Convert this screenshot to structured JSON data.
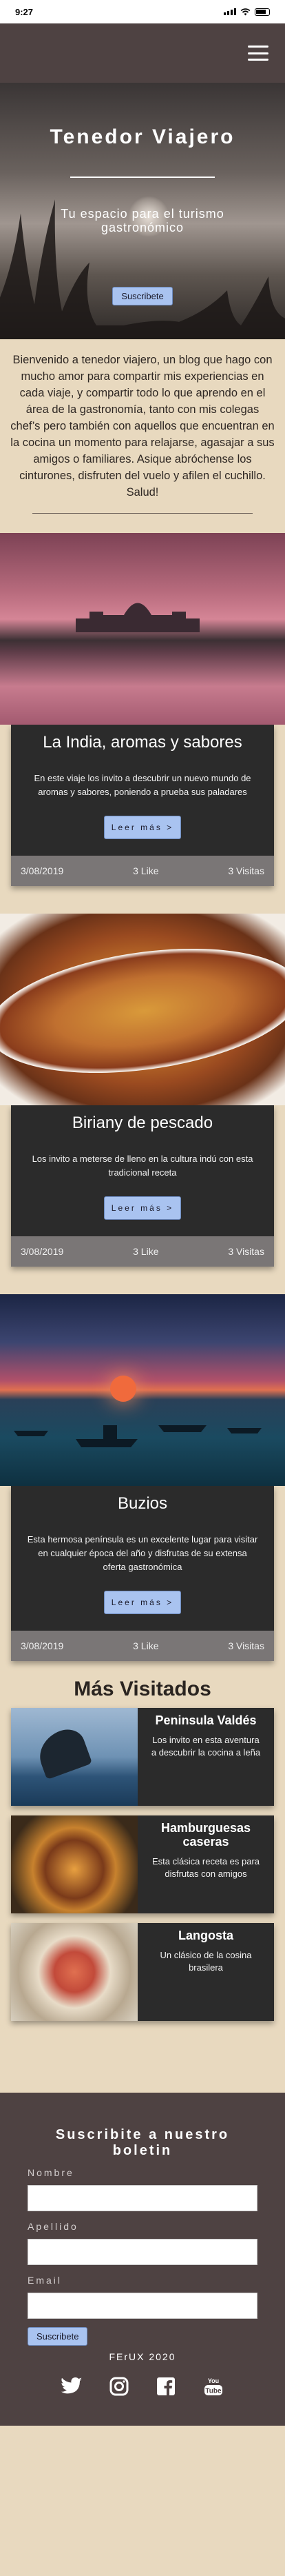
{
  "status_bar": {
    "time": "9:27"
  },
  "hero": {
    "title": "Tenedor Viajero",
    "subtitle": "Tu espacio para el turismo gastronómico",
    "button": "Suscribete"
  },
  "intro": {
    "text": "Bienvenido a tenedor viajero, un blog que hago con mucho amor para compartir mis experiencias en cada viaje, y compartir todo lo que aprendo en el área de la gastronomía, tanto con mis colegas chef’s pero también con aquellos que encuentran en la cocina un momento para relajarse, agasajar a sus amigos o familiares. Asique abróchense los cinturones, disfruten del vuelo y afilen el cuchillo. Salud!"
  },
  "posts": [
    {
      "title": "La India, aromas y sabores",
      "text": "En este viaje los invito a descubrir un nuevo mundo de aromas y sabores, poniendo a prueba sus paladares",
      "button": "Leer más",
      "date": "3/08/2019",
      "likes": "3 Like",
      "visits": "3 Visitas"
    },
    {
      "title": "Biriany de pescado",
      "text": "Los invito a meterse de lleno en la cultura indú con esta tradicional receta",
      "button": "Leer más",
      "date": "3/08/2019",
      "likes": "3 Like",
      "visits": "3 Visitas"
    },
    {
      "title": "Buzios",
      "text": "Esta hermosa península es un excelente lugar para visitar en cualquier época del año y disfrutas de su extensa oferta gastronómica",
      "button": "Leer más",
      "date": "3/08/2019",
      "likes": "3 Like",
      "visits": "3 Visitas"
    }
  ],
  "mas_visitados": {
    "title": "Más Visitados",
    "items": [
      {
        "title": "Peninsula Valdés",
        "text": "Los invito en esta aventura a descubrir la cocina a leña"
      },
      {
        "title": "Hamburguesas caseras",
        "text": "Esta clásica receta es para disfrutas con amigos"
      },
      {
        "title": "Langosta",
        "text": "Un clásico de la cosina brasilera"
      }
    ]
  },
  "footer": {
    "newsletter_title": "Suscribite a nuestro boletin",
    "labels": {
      "nombre": "Nombre",
      "apellido": "Apellido",
      "email": "Email"
    },
    "button": "Suscribete",
    "copyright": "FErUX 2020",
    "socials": [
      "twitter-icon",
      "instagram-icon",
      "facebook-icon",
      "youtube-icon"
    ]
  },
  "colors": {
    "header_bg": "#4e4242",
    "page_bg": "#e8d9bf",
    "card_bg": "#2b2b2b",
    "card_footer_bg": "#7a7676",
    "button_bg": "#a9c3f0"
  }
}
